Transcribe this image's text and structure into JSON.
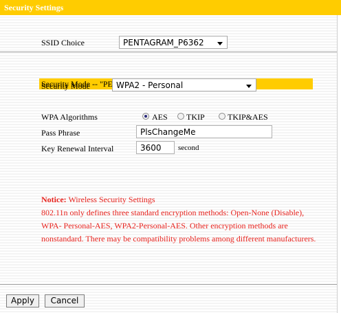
{
  "header": {
    "title": "Security Settings"
  },
  "ssid": {
    "label": "SSID Choice",
    "value": "PENTAGRAM_P6362"
  },
  "security": {
    "banner": "Security Mode -- \"PENTAGRAM_P6362\"",
    "mode_label": "Security Mode",
    "mode_value": "WPA2 - Personal"
  },
  "wpa": {
    "algorithms_label": "WPA Algorithms",
    "options": [
      "AES",
      "TKIP",
      "TKIP&AES"
    ],
    "selected": "AES",
    "passphrase_label": "Pass Phrase",
    "passphrase_value": "PlsChangeMe",
    "renewal_label": "Key Renewal Interval",
    "renewal_value": "3600",
    "renewal_unit": "second"
  },
  "notice": {
    "heading": "Notice:",
    "title": " Wireless Security Settings",
    "body": "802.11n only defines three standard encryption methods: Open-None (Disable), WPA- Personal-AES, WPA2-Personal-AES. Other encryption methods are nonstandard. There may be compatibility problems among different manufacturers."
  },
  "buttons": {
    "apply": "Apply",
    "cancel": "Cancel"
  },
  "colors": {
    "accent": "#ffcc00",
    "notice": "#e8231e"
  }
}
